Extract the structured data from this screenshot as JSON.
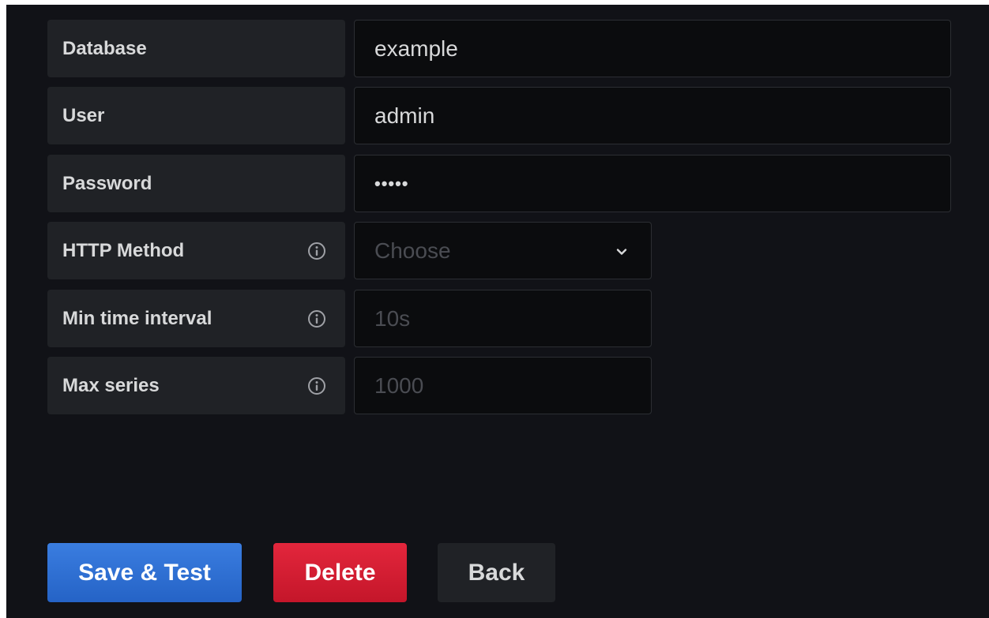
{
  "form": {
    "database": {
      "label": "Database",
      "value": "example"
    },
    "user": {
      "label": "User",
      "value": "admin"
    },
    "password": {
      "label": "Password",
      "value": "•••••"
    },
    "http_method": {
      "label": "HTTP Method",
      "placeholder": "Choose"
    },
    "min_time_interval": {
      "label": "Min time interval",
      "placeholder": "10s"
    },
    "max_series": {
      "label": "Max series",
      "placeholder": "1000"
    }
  },
  "buttons": {
    "save_test": "Save & Test",
    "delete": "Delete",
    "back": "Back"
  },
  "colors": {
    "background": "#111217",
    "label_bg": "#202226",
    "input_bg": "#0b0c0e",
    "primary": "#2f6fd6",
    "destructive": "#d41f35"
  },
  "icons": {
    "info": "info-circle-icon",
    "dropdown": "chevron-down-icon"
  }
}
